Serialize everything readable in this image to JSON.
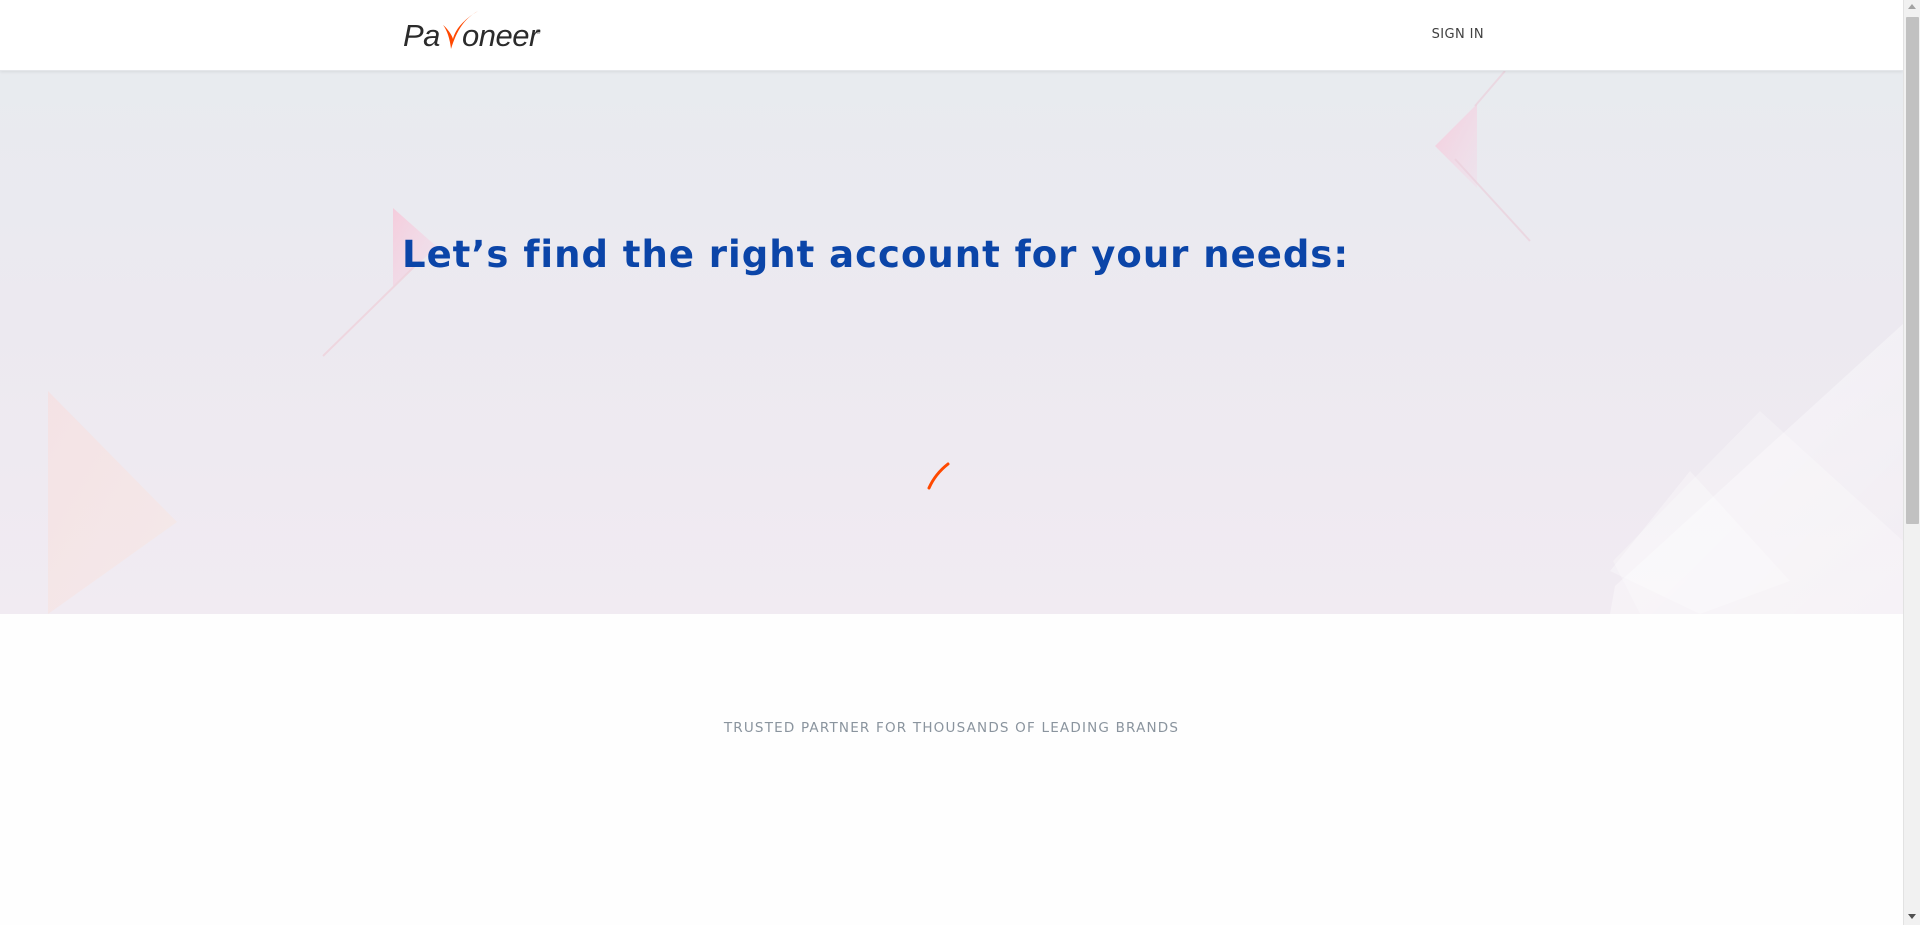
{
  "brand": {
    "name": "Payoneer",
    "logo_text_left": "Pa",
    "logo_text_right": "oneer",
    "logo_mark": "®",
    "primary_color": "#0b45a8",
    "accent_color": "#ff4800",
    "logo_text_color": "#2b2b2b"
  },
  "header": {
    "sign_in_label": "SIGN IN"
  },
  "hero": {
    "title": "Let’s find the right account for your needs:",
    "loading_icon": "spinner-icon"
  },
  "brands": {
    "title": "TRUSTED PARTNER FOR THOUSANDS OF LEADING BRANDS"
  }
}
